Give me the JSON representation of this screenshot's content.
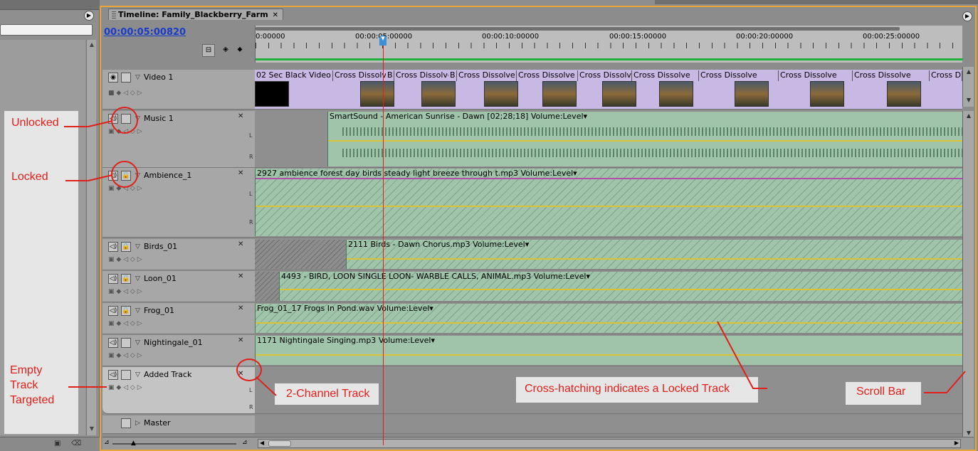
{
  "timeline": {
    "tab_title": "Timeline: Family_Blackberry_Farm",
    "close_glyph": "✕",
    "timecode": "00:00:05:00820"
  },
  "ruler": {
    "labels": [
      "0:00000",
      "00:00:05:00000",
      "00:00:10:00000",
      "00:00:15:00000",
      "00:00:20:00000",
      "00:00:25:00000"
    ]
  },
  "video_track": {
    "name": "Video 1",
    "clips": [
      "02 Sec Black Video",
      "Cross Dissolve",
      "B",
      "Cross Dissolve",
      "B",
      "Cross Dissolve",
      "Cross Dissolve",
      "B",
      "Cross Dissolve",
      "I",
      "Cross Dissolve",
      "Cross Dissolve",
      "I",
      "Cross Dissolve",
      "Cross Dissolve",
      "E",
      "Cross Dissolve",
      "I",
      "Cross Dis"
    ]
  },
  "audio_tracks": [
    {
      "name": "Music 1",
      "clip": "SmartSound - American Sunrise - Dawn [02;28;18]",
      "effect": "Volume:Level"
    },
    {
      "name": "Ambience_1",
      "clip": "2927 ambience forest day birds steady light breeze through t.mp3",
      "effect": "Volume:Level"
    },
    {
      "name": "Birds_01",
      "clip": "2111 Birds - Dawn Chorus.mp3",
      "effect": "Volume:Level"
    },
    {
      "name": "Loon_01",
      "clip": "4493 - BIRD, LOON SINGLE LOON- WARBLE CALLS, ANIMAL.mp3",
      "effect": "Volume:Level"
    },
    {
      "name": "Frog_01",
      "clip": "Frog_01_17 Frogs In Pond.wav",
      "effect": "Volume:Level"
    },
    {
      "name": "Nightingale_01",
      "clip": "1171 Nightingale Singing.mp3",
      "effect": "Volume:Level"
    },
    {
      "name": "Added Track",
      "clip": "",
      "effect": ""
    }
  ],
  "master_track": {
    "name": "Master"
  },
  "annotations": {
    "unlocked": "Unlocked",
    "locked": "Locked",
    "empty_line1": "Empty",
    "empty_line2": "Track",
    "empty_line3": "Targeted",
    "two_channel": "2-Channel Track",
    "cross_hatching": "Cross-hatching indicates a Locked Track",
    "scroll_bar": "Scroll Bar"
  },
  "icons": {
    "speaker": "speaker-icon",
    "eye": "eye-icon",
    "lock": "lock-icon",
    "stereo": "stereo-channel-icon"
  },
  "colors": {
    "panel_border": "#e6a63c",
    "annotation": "#e0201a",
    "audio_clip": "#9fc4a9",
    "video_clip": "#c8b8e4",
    "timecode": "#1a3cc8"
  }
}
